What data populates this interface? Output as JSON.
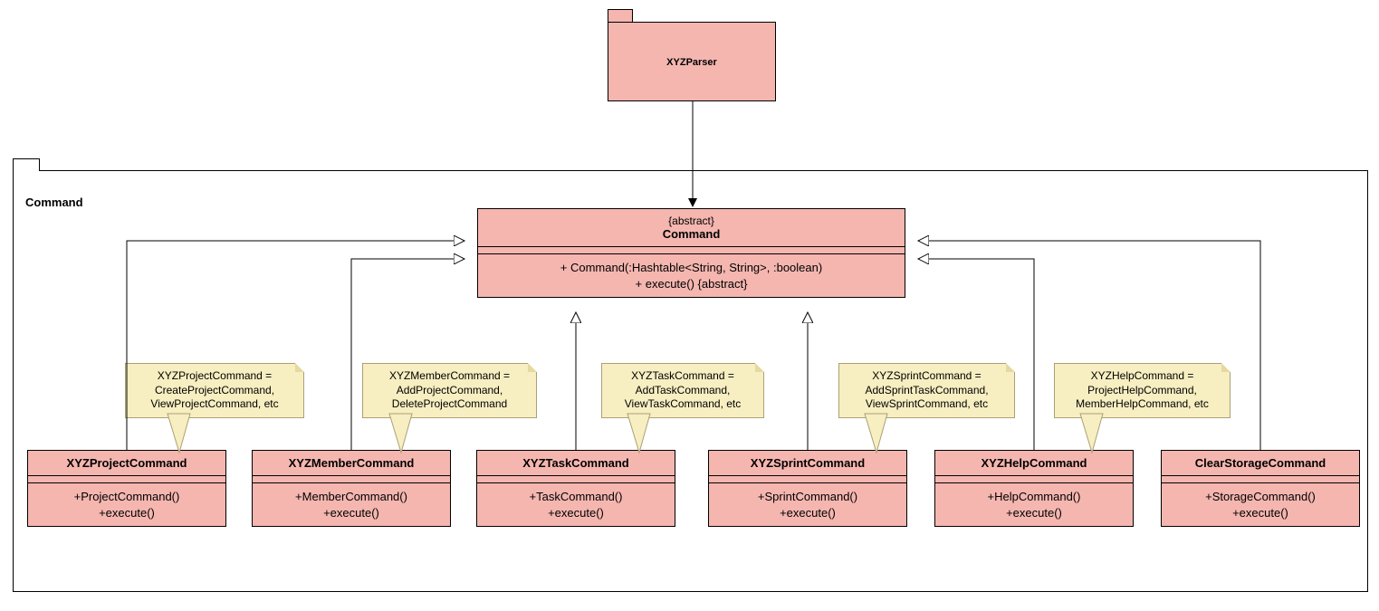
{
  "parser": {
    "name": "XYZParser"
  },
  "outerPackage": {
    "name": "Command"
  },
  "commandClass": {
    "stereotype": "{abstract}",
    "name": "Command",
    "method1": "+ Command(:Hashtable<String, String>, :boolean)",
    "method2": "+ execute() {abstract}"
  },
  "subs": [
    {
      "name": "XYZProjectCommand",
      "m1": "+ProjectCommand()",
      "m2": "+execute()"
    },
    {
      "name": "XYZMemberCommand",
      "m1": "+MemberCommand()",
      "m2": "+execute()"
    },
    {
      "name": "XYZTaskCommand",
      "m1": "+TaskCommand()",
      "m2": "+execute()"
    },
    {
      "name": "XYZSprintCommand",
      "m1": "+SprintCommand()",
      "m2": "+execute()"
    },
    {
      "name": "XYZHelpCommand",
      "m1": "+HelpCommand()",
      "m2": "+execute()"
    },
    {
      "name": "ClearStorageCommand",
      "m1": "+StorageCommand()",
      "m2": "+execute()"
    }
  ],
  "notes": [
    {
      "l1": "XYZProjectCommand =",
      "l2": "CreateProjectCommand,",
      "l3": "ViewProjectCommand, etc"
    },
    {
      "l1": "XYZMemberCommand =",
      "l2": "AddProjectCommand,",
      "l3": "DeleteProjectCommand"
    },
    {
      "l1": "XYZTaskCommand =",
      "l2": "AddTaskCommand,",
      "l3": "ViewTaskCommand, etc"
    },
    {
      "l1": "XYZSprintCommand =",
      "l2": "AddSprintTaskCommand,",
      "l3": "ViewSprintCommand, etc"
    },
    {
      "l1": "XYZHelpCommand =",
      "l2": "ProjectHelpCommand,",
      "l3": "MemberHelpCommand, etc"
    }
  ]
}
